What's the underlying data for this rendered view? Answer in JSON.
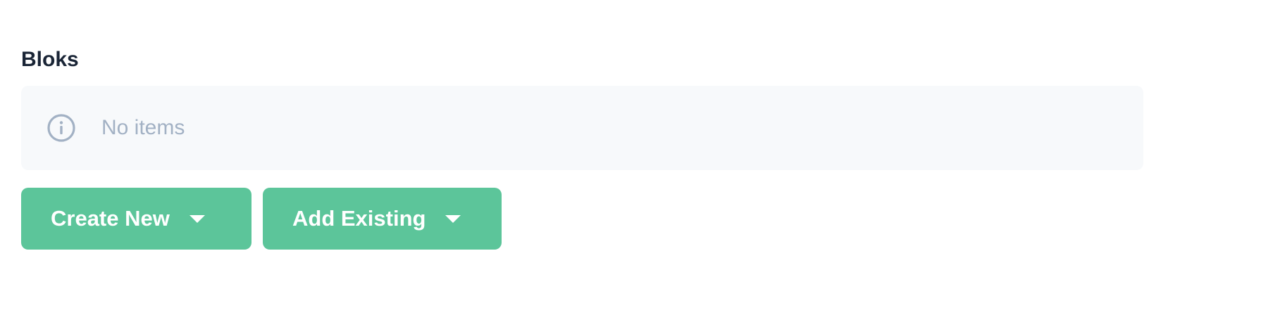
{
  "field": {
    "label": "Bloks",
    "empty_text": "No items",
    "info_icon": "info-circle-icon"
  },
  "actions": {
    "create_new_label": "Create New",
    "add_existing_label": "Add Existing",
    "caret_icon": "caret-down-icon"
  },
  "colors": {
    "button": "#5cc59a",
    "empty_bg": "#f7f9fb",
    "muted_text": "#a2b1c4",
    "label_text": "#1a2536"
  }
}
